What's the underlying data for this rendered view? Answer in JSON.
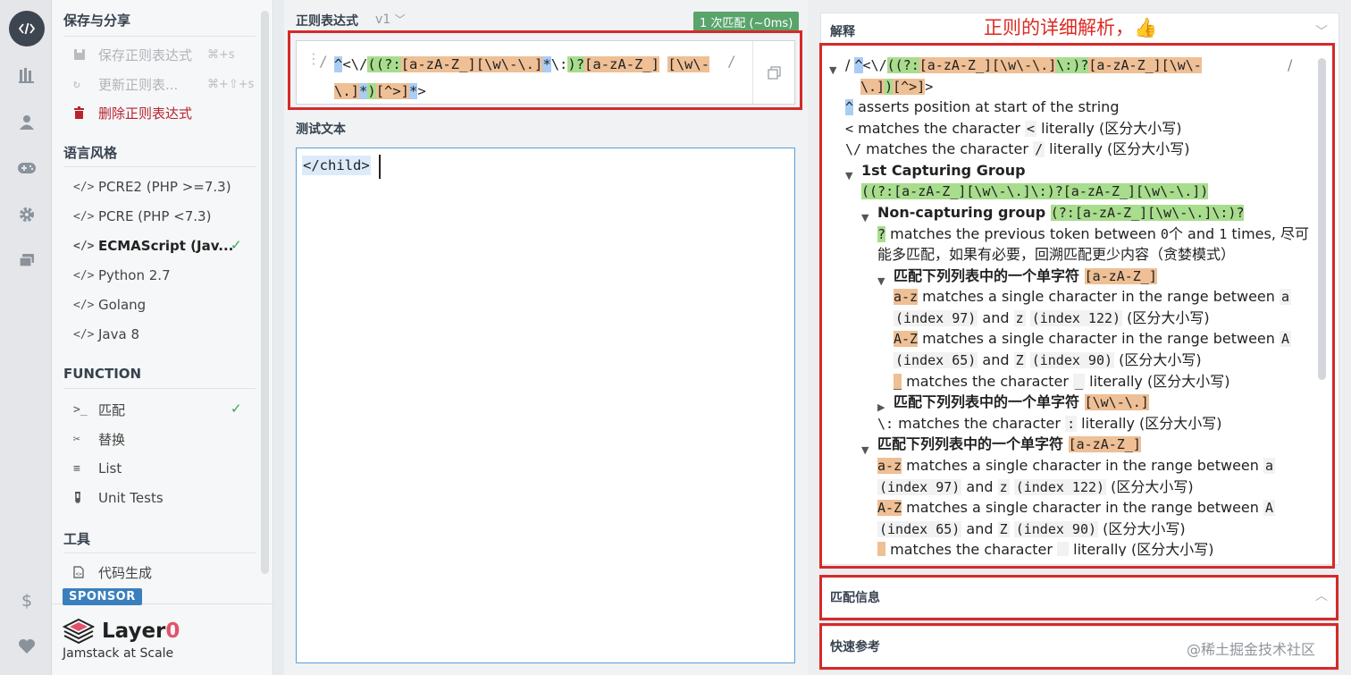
{
  "iconbar": {
    "icons": [
      "code-icon",
      "library-icon",
      "user-icon",
      "gamepad-icon",
      "gear-icon",
      "chat-icon"
    ],
    "bottom_icons": [
      "dollar-icon",
      "heart-icon"
    ]
  },
  "sidebar": {
    "save_share_title": "保存与分享",
    "save_label": "保存正则表达式",
    "save_kbd": "⌘+s",
    "update_label": "更新正则表...",
    "update_kbd": "⌘+⇧+s",
    "delete_label": "删除正则表达式",
    "flavor_title": "语言风格",
    "flavors": [
      "PCRE2 (PHP >=7.3)",
      "PCRE (PHP <7.3)",
      "ECMAScript (Jav...",
      "Python 2.7",
      "Golang",
      "Java 8"
    ],
    "function_title": "FUNCTION",
    "functions": [
      "匹配",
      "替换",
      "List",
      "Unit Tests"
    ],
    "tools_title": "工具",
    "tools": [
      "代码生成"
    ],
    "sponsor_label": "SPONSOR",
    "sponsor_name": "Layer",
    "sponsor_suffix": "0",
    "sponsor_tagline": "Jamstack at Scale"
  },
  "editor": {
    "regex_title": "正则表达式",
    "version": "v1",
    "match_badge": "1 次匹配 (~0ms)",
    "delimiter": "/",
    "regex_parts": {
      "p1": "^",
      "p2": "<\\/",
      "p3": "(",
      "p4": "(?:",
      "p5": "[a-zA-Z_]",
      "p6": "[\\w\\-\\.]",
      "p7": "*",
      "p8": "\\:",
      "p9": ")?",
      "p10": "[a-zA-Z_]",
      "p11": "[\\w\\-\\.]",
      "p12": "*",
      "p13": ")",
      "p14": "[^>]",
      "p15": "*",
      "p16": ">"
    },
    "test_title": "测试文本",
    "test_text": "</child>"
  },
  "explanation": {
    "title": "解释",
    "annotation": "正则的详细解析，👍",
    "lines": {
      "l1a": "/ ",
      "l1b": "^",
      "l1c": "<\\/",
      "l1d": "((?:",
      "l1e": "[a-zA-Z_]",
      "l1f": "[\\w\\-\\.]",
      "l1g": "\\:)?",
      "l1h": "[a-zA-Z_]",
      "l1i": "[\\w\\-",
      "l1j": "/",
      "l2a": "\\.]",
      "l2b": ")",
      "l2c": "[^>]",
      "l2d": ">",
      "l3a": "^",
      "l3b": " asserts position at start of the string",
      "l4a": "<",
      "l4b": " matches the character ",
      "l4c": "<",
      "l4d": " literally (区分大小写)",
      "l5a": "\\/",
      "l5b": " matches the character ",
      "l5c": "/",
      "l5d": " literally (区分大小写)",
      "l6": "1st Capturing Group",
      "l7": "((?:[a-zA-Z_][\\w\\-\\.]\\:)?[a-zA-Z_][\\w\\-\\.])",
      "l8a": "Non-capturing group ",
      "l8b": "(?:[a-zA-Z_][\\w\\-\\.]\\:)?",
      "l9a": "?",
      "l9b": " matches the previous token between ",
      "l9c": "0",
      "l9d": "个 and ",
      "l9e": "1",
      "l9f": " times, 尽可",
      "l10": "能多匹配，如果有必要，回溯匹配更少内容（贪婪模式）",
      "l11a": "匹配下列列表中的一个单字符 ",
      "l11b": "[a-zA-Z_]",
      "l12a": "a-z",
      "l12b": " matches a single character in the range between ",
      "l12c": "a",
      "l13a": "(index 97)",
      "l13b": " and ",
      "l13c": "z",
      "l13d": "(index 122)",
      "l13e": " (区分大小写)",
      "l14a": "A-Z",
      "l14b": " matches a single character in the range between ",
      "l14c": "A",
      "l15a": "(index 65)",
      "l15b": " and ",
      "l15c": "Z",
      "l15d": "(index 90)",
      "l15e": " (区分大小写)",
      "l16a": "_",
      "l16b": " matches the character ",
      "l16c": "_",
      "l16d": " literally (区分大小写)",
      "l17a": "匹配下列列表中的一个单字符 ",
      "l17b": "[\\w\\-\\.]",
      "l18a": "\\:",
      "l18b": " matches the character ",
      "l18c": ":",
      "l18d": " literally (区分大小写)",
      "l19a": "匹配下列列表中的一个单字符 ",
      "l19b": "[a-zA-Z_]",
      "l20a": "a-z",
      "l20b": " matches a single character in the range between ",
      "l20c": "a",
      "l21a": "(index 97)",
      "l21b": " and ",
      "l21c": "z",
      "l21d": "(index 122)",
      "l21e": " (区分大小写)",
      "l22a": "A-Z",
      "l22b": " matches a single character in the range between ",
      "l22c": "A",
      "l23a": "(index 65)",
      "l23b": " and ",
      "l23c": "Z",
      "l23d": "(index 90)",
      "l23e": " (区分大小写)",
      "l24a": "_",
      "l24b": " matches the character ",
      "l24c": "_",
      "l24d": " literally (区分大小写)"
    }
  },
  "match_info": {
    "title": "匹配信息"
  },
  "quick_ref": {
    "title": "快速参考"
  },
  "watermark": "@稀土掘金技术社区",
  "colors": {
    "annotation_red": "#d52a2a",
    "match_green": "#5aa46b",
    "accent_blue": "#3a7fbd",
    "highlight_orange": "#efbf95",
    "highlight_green": "#a8dd8d",
    "highlight_blue": "#a9cdf5"
  }
}
